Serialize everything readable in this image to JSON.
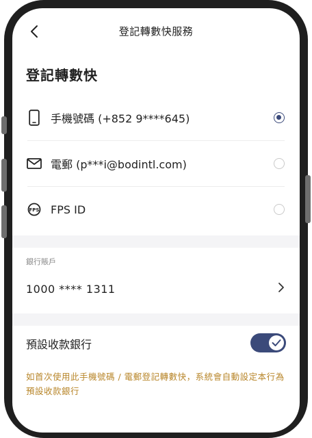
{
  "nav": {
    "title": "登記轉數快服務"
  },
  "page": {
    "title": "登記轉數快"
  },
  "options": [
    {
      "label": "手機號碼 (+852 9****645)",
      "icon": "mobile-phone-icon",
      "selected": true
    },
    {
      "label": "電郵 (p***i@bodintl.com)",
      "icon": "envelope-icon",
      "selected": false
    },
    {
      "label": "FPS ID",
      "icon": "fps-icon",
      "selected": false
    }
  ],
  "bank": {
    "label": "銀行賬戶",
    "account": "1000 **** 1311"
  },
  "default_bank": {
    "label": "預設收款銀行",
    "enabled": true
  },
  "notice": "如首次使用此手機號碼 / 電郵登記轉數快，系統會自動設定本行為預設收款銀行",
  "colors": {
    "accent": "#3b4a7a",
    "notice": "#b8862a",
    "band": "#f4f4f6"
  }
}
